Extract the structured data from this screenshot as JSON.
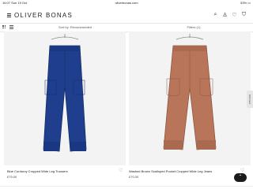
{
  "status_bar": {
    "time": "16:07",
    "date": "Sun 19 Oct",
    "url": "oliverbonas.com",
    "battery": "53% ▭"
  },
  "header": {
    "logo": "OLIVER BONAS"
  },
  "controls": {
    "sort_label": "Sort by: Recommended",
    "filter_label": "Filters (1)"
  },
  "products": [
    {
      "name": "Blue Corduroy Cropped Wide Leg Trousers",
      "price": "£79.00",
      "color": "#1f3f8e"
    },
    {
      "name": "Washed Brown Scalloped Pocket Cropped Wide Leg Jeans",
      "price": "£70.00",
      "color": "#b9755a"
    }
  ],
  "side_tab": {
    "label": "Gift Card"
  },
  "icons": [
    "menu-icon",
    "search-icon",
    "user-icon",
    "heart-icon",
    "bag-icon",
    "grid-icon",
    "list-icon",
    "chevron-up-icon"
  ]
}
